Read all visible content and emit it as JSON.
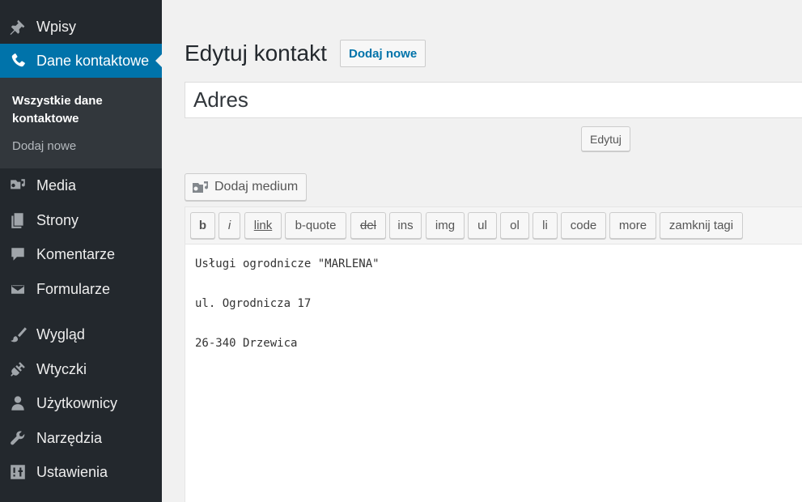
{
  "sidebar": {
    "items": [
      {
        "label": "Wpisy",
        "icon": "pin-icon"
      },
      {
        "label": "Dane kontaktowe",
        "icon": "phone-icon",
        "active": true
      },
      {
        "label": "Media",
        "icon": "media-icon"
      },
      {
        "label": "Strony",
        "icon": "pages-icon"
      },
      {
        "label": "Komentarze",
        "icon": "comment-icon"
      },
      {
        "label": "Formularze",
        "icon": "mail-icon"
      },
      {
        "label": "Wygląd",
        "icon": "brush-icon"
      },
      {
        "label": "Wtyczki",
        "icon": "plugin-icon"
      },
      {
        "label": "Użytkownicy",
        "icon": "user-icon"
      },
      {
        "label": "Narzędzia",
        "icon": "wrench-icon"
      },
      {
        "label": "Ustawienia",
        "icon": "settings-icon"
      }
    ],
    "submenu": {
      "current": "Wszystkie dane kontaktowe",
      "add_new": "Dodaj nowe"
    }
  },
  "main": {
    "page_title": "Edytuj kontakt",
    "add_new_button": "Dodaj nowe",
    "title_value": "Adres",
    "edit_button": "Edytuj",
    "add_media_button": "Dodaj medium",
    "quicktags": [
      "b",
      "i",
      "link",
      "b-quote",
      "del",
      "ins",
      "img",
      "ul",
      "ol",
      "li",
      "code",
      "more",
      "zamknij tagi"
    ],
    "content_lines": [
      "Usługi ogrodnicze \"MARLENA\"",
      "",
      "ul. Ogrodnicza 17",
      "",
      "26-340 Drzewica"
    ]
  },
  "colors": {
    "sidebar_bg": "#23282d",
    "submenu_bg": "#32373c",
    "active_bg": "#0073aa",
    "link": "#0073aa"
  }
}
